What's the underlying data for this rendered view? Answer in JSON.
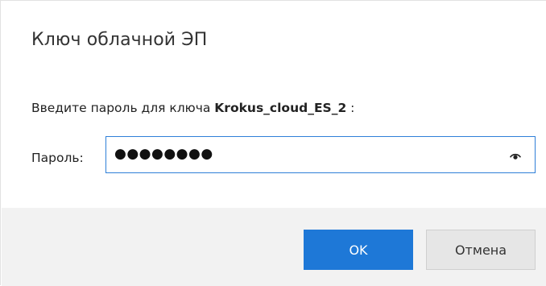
{
  "dialog": {
    "title": "Ключ облачной ЭП",
    "prompt_prefix": "Введите пароль для ключа ",
    "key_name": "Krokus_cloud_ES_2",
    "prompt_suffix": " :",
    "password_label": "Пароль:",
    "password_masked": "●●●●●●●●",
    "ok_label": "OK",
    "cancel_label": "Отмена"
  },
  "icons": {
    "reveal": "eye-icon"
  },
  "colors": {
    "accent": "#1e78d7",
    "input_border": "#2f7fd8",
    "footer_bg": "#f2f2f2"
  }
}
